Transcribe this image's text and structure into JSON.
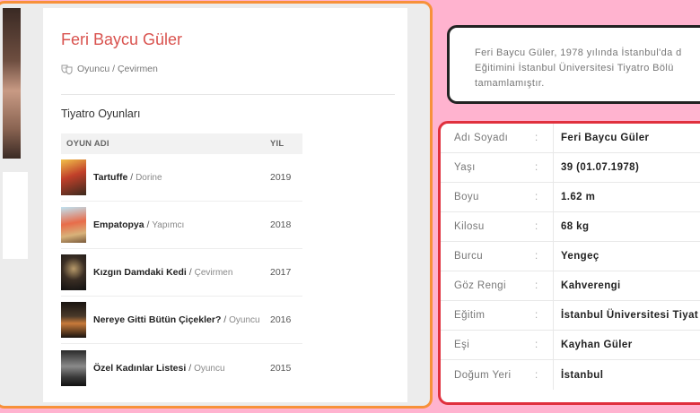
{
  "person": {
    "name": "Feri Baycu Güler",
    "roles": "Oyuncu / Çevirmen"
  },
  "plays": {
    "title": "Tiyatro Oyunları",
    "header": {
      "name": "OYUN ADI",
      "year": "YIL"
    },
    "rows": [
      {
        "title": "Tartuffe",
        "sep": " / ",
        "role": "Dorine",
        "year": "2019"
      },
      {
        "title": "Empatopya",
        "sep": " / ",
        "role": "Yapımcı",
        "year": "2018"
      },
      {
        "title": "Kızgın Damdaki Kedi",
        "sep": " / ",
        "role": "Çevirmen",
        "year": "2017"
      },
      {
        "title": "Nereye Gitti Bütün Çiçekler?",
        "sep": " / ",
        "role": "Oyuncu",
        "year": "2016"
      },
      {
        "title": "Özel Kadınlar Listesi",
        "sep": " / ",
        "role": "Oyuncu",
        "year": "2015"
      }
    ]
  },
  "bio": {
    "line1": "Feri Baycu Güler, 1978 yılında İstanbul'da d",
    "line2": "Eğitimini İstanbul Üniversitesi Tiyatro Bölü",
    "line3": "tamamlamıştır."
  },
  "info": [
    {
      "label": "Adı Soyadı",
      "colon": ":",
      "value": "Feri Baycu Güler"
    },
    {
      "label": "Yaşı",
      "colon": ":",
      "value": "39 (01.07.1978)"
    },
    {
      "label": "Boyu",
      "colon": ":",
      "value": "1.62 m"
    },
    {
      "label": "Kilosu",
      "colon": ":",
      "value": "68 kg"
    },
    {
      "label": "Burcu",
      "colon": ":",
      "value": "Yengeç"
    },
    {
      "label": "Göz Rengi",
      "colon": ":",
      "value": "Kahverengi"
    },
    {
      "label": "Eğitim",
      "colon": ":",
      "value": "İstanbul Üniversitesi Tiyat"
    },
    {
      "label": "Eşi",
      "colon": ":",
      "value": "Kayhan Güler"
    },
    {
      "label": "Doğum Yeri",
      "colon": ":",
      "value": "İstanbul"
    }
  ]
}
